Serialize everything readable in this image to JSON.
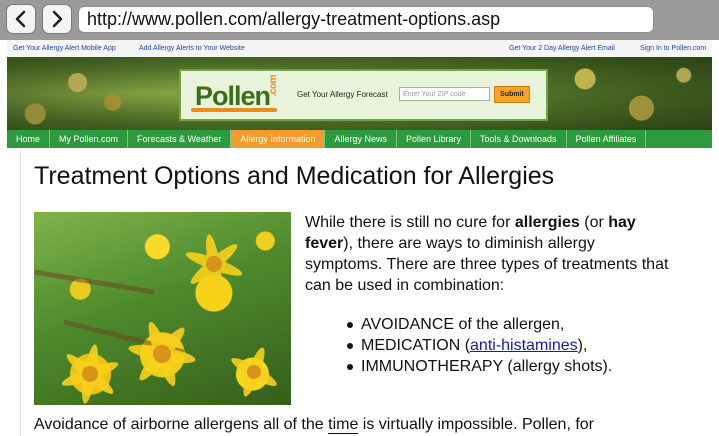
{
  "browser": {
    "back_label": "<",
    "forward_label": ">",
    "url": "http://www.pollen.com/allergy-treatment-options.asp"
  },
  "toplinks": {
    "mobile_app": "Get Your Allergy Alert Mobile App",
    "website_alerts": "Add Allergy Alerts to Your Website",
    "email_alert": "Get Your 2 Day Allergy Alert Email",
    "sign_in": "Sign In to Pollen.com"
  },
  "banner": {
    "logo_text": "Pollen",
    "logo_dotcom": ".com",
    "forecast_label": "Get Your Allergy Forecast",
    "zip_placeholder": "Enter Your ZIP code",
    "submit_label": "Submit"
  },
  "nav": {
    "items": [
      "Home",
      "My Pollen.com",
      "Forecasts & Weather",
      "Allergy Information",
      "Allergy News",
      "Pollen Library",
      "Tools & Downloads",
      "Pollen Affiliates"
    ],
    "active": "Allergy Information"
  },
  "content": {
    "title": "Treatment Options and Medication for Allergies",
    "intro": {
      "p1": "While there is still no cure for ",
      "b1": "allergies",
      "p2": " (or ",
      "b2": "hay fever",
      "p3": "), there are ways to diminish allergy symptoms. There are three types of treatments that can be used in combination:"
    },
    "bullets": {
      "avoidance": "AVOIDANCE of the allergen,",
      "medication_prefix": "MEDICATION (",
      "medication_link": "anti-histamines",
      "medication_suffix": "),",
      "immunotherapy": "IMMUNOTHERAPY (allergy shots)."
    },
    "outro": {
      "before": "Avoidance of airborne allergens all of the ",
      "underlined": "time",
      "after": " is virtually impossible. Pollen, for"
    }
  },
  "colors": {
    "nav_green": "#2f9a3d",
    "nav_active_orange": "#f39b2c",
    "link_blue": "#1a1aa8",
    "logo_green": "#3c6d1c"
  },
  "icons": {
    "back": "chevron-left-icon",
    "forward": "chevron-right-icon"
  }
}
